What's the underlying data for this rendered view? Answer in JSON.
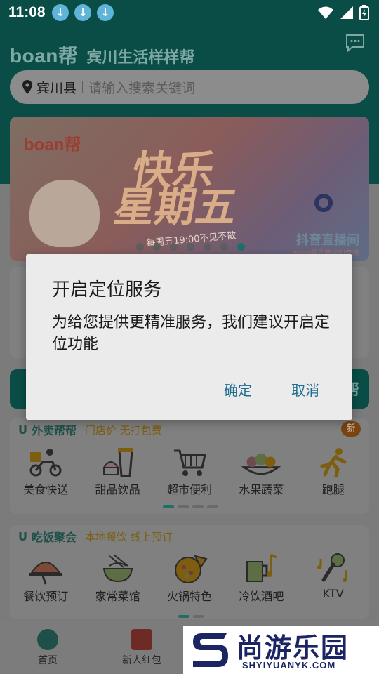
{
  "status_bar": {
    "time": "11:08",
    "download_count": 3
  },
  "header": {
    "brand_logo": "boan帮",
    "brand_tagline": "宾川生活样样帮",
    "message_icon": "message-icon"
  },
  "search": {
    "location": "宾川县",
    "placeholder": "请输入搜索关键词"
  },
  "banner": {
    "logo": "boan帮",
    "title_line1": "快乐",
    "title_line2": "星期五",
    "subtitle": "每周五19:00不见不散",
    "live_text": "抖音直播间",
    "live_sub": "Boan帮品牌福利专场",
    "dot_count": 7,
    "active_dot": 6
  },
  "peek_bar_char": "帮",
  "waimai": {
    "title": "外卖帮帮",
    "subtitle": "门店价 无打包费",
    "badge": "新",
    "items": [
      {
        "label": "美食快送",
        "icon": "scooter-icon"
      },
      {
        "label": "甜品饮品",
        "icon": "drink-icon"
      },
      {
        "label": "超市便利",
        "icon": "cart-icon"
      },
      {
        "label": "水果蔬菜",
        "icon": "fruit-icon"
      },
      {
        "label": "跑腿",
        "icon": "runner-icon"
      }
    ]
  },
  "dining": {
    "title": "吃饭聚会",
    "subtitle": "本地餐饮 线上预订",
    "items": [
      {
        "label": "餐饮预订",
        "icon": "dish-icon"
      },
      {
        "label": "家常菜馆",
        "icon": "noodle-icon"
      },
      {
        "label": "火锅特色",
        "icon": "pizza-icon"
      },
      {
        "label": "冷饮酒吧",
        "icon": "beer-icon"
      },
      {
        "label": "KTV",
        "icon": "microphone-icon"
      }
    ]
  },
  "tabbar": {
    "home": "首页",
    "redpacket": "新人红包"
  },
  "watermark": {
    "cn": "尚游乐园",
    "en": "SHYIYUANYK.COM"
  },
  "dialog": {
    "title": "开启定位服务",
    "message": "为给您提供更精准服务，我们建议开启定位功能",
    "confirm": "确定",
    "cancel": "取消"
  },
  "colors": {
    "header_green": "#0a4d47",
    "accent_blue": "#1f6b8f",
    "dim_overlay": "#7c7c7c"
  }
}
